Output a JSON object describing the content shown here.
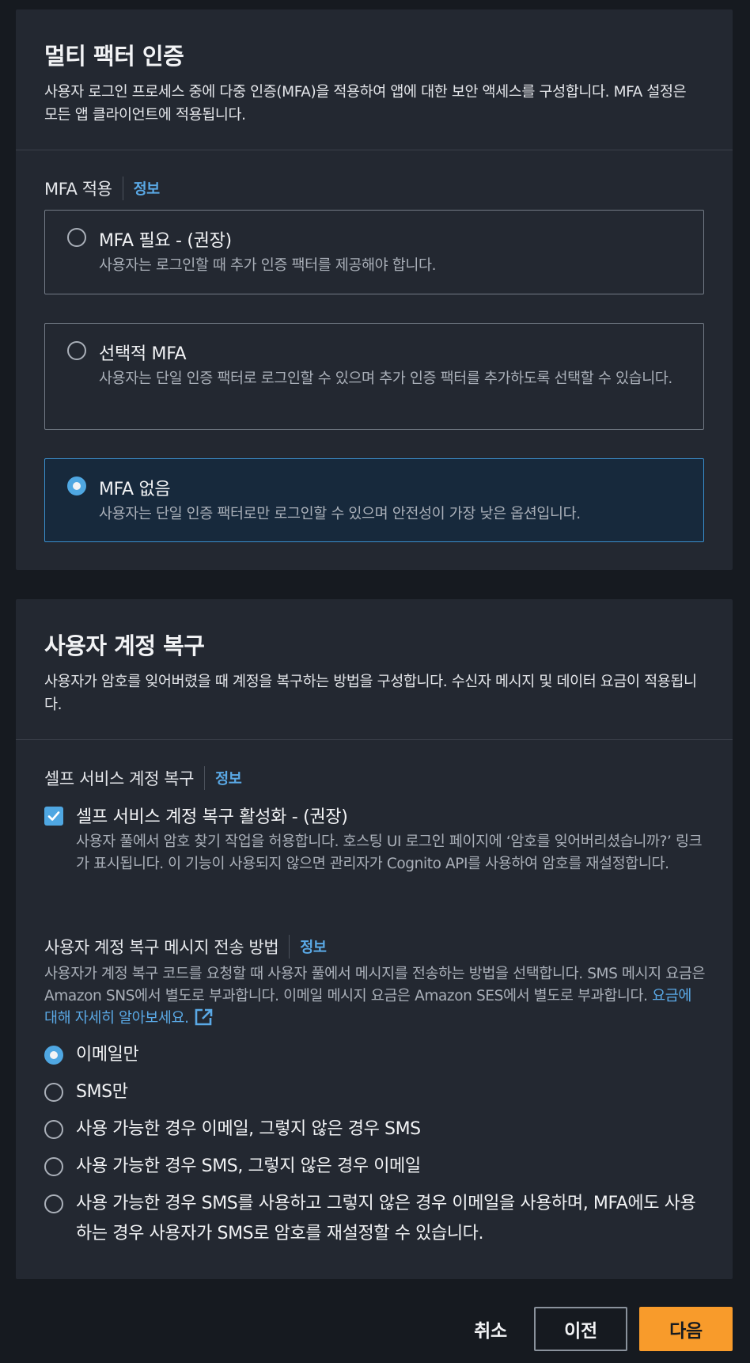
{
  "mfa": {
    "title": "멀티 팩터 인증",
    "description": "사용자 로그인 프로세스 중에 다중 인증(MFA)을 적용하여 앱에 대한 보안 액세스를 구성합니다. MFA 설정은 모든 앱 클라이언트에 적용됩니다.",
    "enforcement_label": "MFA 적용",
    "info_label": "정보",
    "options": [
      {
        "title": "MFA 필요 - (권장)",
        "description": "사용자는 로그인할 때 추가 인증 팩터를 제공해야 합니다.",
        "selected": false
      },
      {
        "title": "선택적 MFA",
        "description": "사용자는 단일 인증 팩터로 로그인할 수 있으며 추가 인증 팩터를 추가하도록 선택할 수 있습니다.",
        "selected": false
      },
      {
        "title": "MFA 없음",
        "description": "사용자는 단일 인증 팩터로만 로그인할 수 있으며 안전성이 가장 낮은 옵션입니다.",
        "selected": true
      }
    ]
  },
  "recovery": {
    "title": "사용자 계정 복구",
    "description": "사용자가 암호를 잊어버렸을 때 계정을 복구하는 방법을 구성합니다. 수신자 메시지 및 데이터 요금이 적용됩니다.",
    "self_service_label": "셀프 서비스 계정 복구",
    "info_label": "정보",
    "self_service_checkbox": {
      "label": "셀프 서비스 계정 복구 활성화 - (권장)",
      "description": "사용자 풀에서 암호 찾기 작업을 허용합니다. 호스팅 UI 로그인 페이지에 ‘암호를 잊어버리셨습니까?’ 링크가 표시됩니다. 이 기능이 사용되지 않으면 관리자가 Cognito API를 사용하여 암호를 재설정합니다.",
      "checked": true
    },
    "delivery_label": "사용자 계정 복구 메시지 전송 방법",
    "delivery_description": "사용자가 계정 복구 코드를 요청할 때 사용자 풀에서 메시지를 전송하는 방법을 선택합니다. SMS 메시지 요금은 Amazon SNS에서 별도로 부과합니다. 이메일 메시지 요금은 Amazon SES에서 별도로 부과합니다. ",
    "pricing_link": "요금에 대해 자세히 알아보세요.",
    "delivery_options": [
      {
        "label": "이메일만",
        "selected": true
      },
      {
        "label": "SMS만",
        "selected": false
      },
      {
        "label": "사용 가능한 경우 이메일, 그렇지 않은 경우 SMS",
        "selected": false
      },
      {
        "label": "사용 가능한 경우 SMS, 그렇지 않은 경우 이메일",
        "selected": false
      },
      {
        "label": "사용 가능한 경우 SMS를 사용하고 그렇지 않은 경우 이메일을 사용하며, MFA에도 사용하는 경우 사용자가 SMS로 암호를 재설정할 수 있습니다.",
        "selected": false
      }
    ]
  },
  "footer": {
    "cancel_label": "취소",
    "previous_label": "이전",
    "next_label": "다음"
  },
  "colors": {
    "accent": "#4fa7e2",
    "primary_button": "#f89b2b",
    "link": "#5aa9e6"
  }
}
